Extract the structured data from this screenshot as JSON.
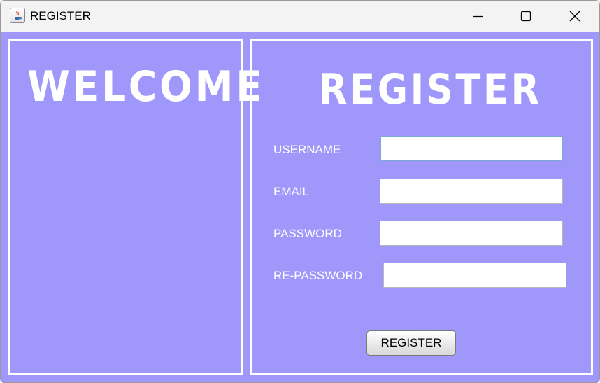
{
  "window": {
    "title": "REGISTER",
    "controls": [
      "minimize",
      "maximize",
      "close"
    ]
  },
  "left_panel": {
    "heading": "WELCOME"
  },
  "register_panel": {
    "heading": "REGISTER",
    "fields": [
      {
        "label": "USERNAME",
        "value": "",
        "focused": true
      },
      {
        "label": "EMAIL",
        "value": ""
      },
      {
        "label": "PASSWORD",
        "value": ""
      },
      {
        "label": "RE-PASSWORD",
        "value": ""
      }
    ],
    "submit_label": "REGISTER"
  },
  "colors": {
    "background": "#a097fb",
    "panel_border": "#ffffff",
    "text": "#ffffff",
    "titlebar": "#f3f3f3"
  },
  "icons": {
    "app": "java-coffee-cup-icon",
    "minimize": "minimize-icon",
    "maximize": "maximize-icon",
    "close": "close-icon"
  }
}
